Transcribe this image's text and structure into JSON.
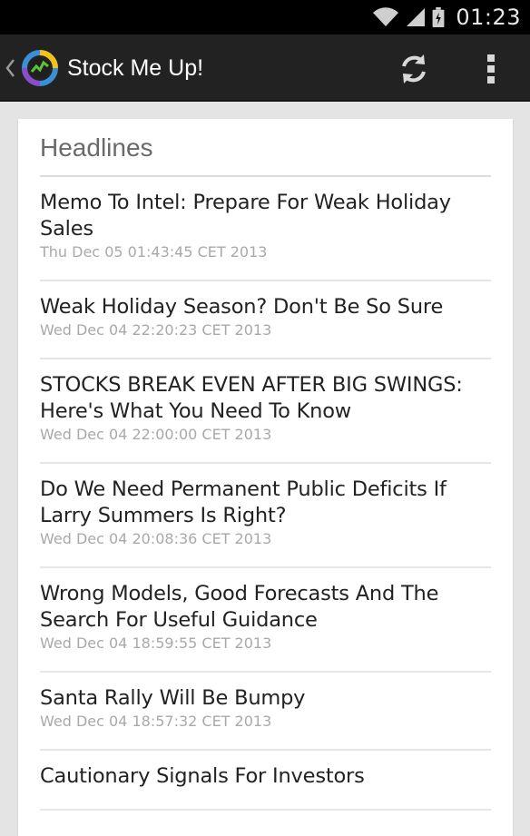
{
  "status_bar": {
    "time": "01:23",
    "icons": [
      "wifi-icon",
      "signal-icon",
      "battery-icon"
    ]
  },
  "action_bar": {
    "title": "Stock Me Up!",
    "icons": [
      "up-caret-icon",
      "app-logo-icon",
      "refresh-icon",
      "overflow-menu-icon"
    ]
  },
  "headlines": {
    "title": "Headlines",
    "items": [
      {
        "title": "Memo To Intel: Prepare For Weak Holiday Sales",
        "date": "Thu Dec 05 01:43:45 CET 2013"
      },
      {
        "title": "Weak Holiday Season? Don't Be So Sure",
        "date": "Wed Dec 04 22:20:23 CET 2013"
      },
      {
        "title": "STOCKS BREAK EVEN AFTER BIG SWINGS: Here's What You Need To Know",
        "date": "Wed Dec 04 22:00:00 CET 2013"
      },
      {
        "title": "Do We Need Permanent Public Deficits If Larry Summers Is Right?",
        "date": "Wed Dec 04 20:08:36 CET 2013"
      },
      {
        "title": "Wrong Models, Good Forecasts And The Search For Useful Guidance",
        "date": "Wed Dec 04 18:59:55 CET 2013"
      },
      {
        "title": "Santa Rally Will Be Bumpy",
        "date": "Wed Dec 04 18:57:32 CET 2013"
      },
      {
        "title": "Cautionary Signals For Investors",
        "date": ""
      }
    ]
  },
  "colors": {
    "status_bar": "#000000",
    "action_bar": "#222222",
    "background": "#e4e4e4",
    "card": "#ffffff",
    "headline_text": "#222222",
    "date_text": "#a9a9a9",
    "logo_blue": "#3b8fd6",
    "logo_purple": "#8a4fc8",
    "logo_yellow": "#f2c21b",
    "logo_green": "#5cc23a"
  }
}
